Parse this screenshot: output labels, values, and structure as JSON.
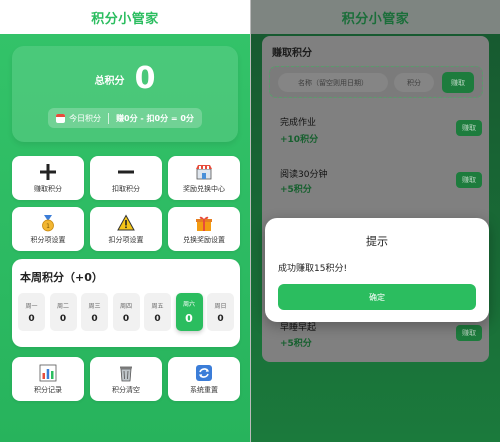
{
  "app_title": "积分小管家",
  "home": {
    "total_label": "总积分",
    "total_value": "0",
    "today_label": "今日积分",
    "today_formula": "赚0分 - 扣0分 = 0分",
    "menu_row1": [
      {
        "label": "赚取积分",
        "icon": "plus-icon"
      },
      {
        "label": "扣取积分",
        "icon": "minus-icon"
      },
      {
        "label": "奖励兑换中心",
        "icon": "shop-icon"
      }
    ],
    "menu_row2": [
      {
        "label": "积分项设置",
        "icon": "medal-icon"
      },
      {
        "label": "扣分项设置",
        "icon": "warning-icon"
      },
      {
        "label": "兑换奖励设置",
        "icon": "gift-icon"
      }
    ],
    "week_title": "本周积分（+0）",
    "days": [
      {
        "name": "周一",
        "value": "0"
      },
      {
        "name": "周二",
        "value": "0"
      },
      {
        "name": "周三",
        "value": "0"
      },
      {
        "name": "周四",
        "value": "0"
      },
      {
        "name": "周五",
        "value": "0"
      },
      {
        "name": "周六",
        "value": "0"
      },
      {
        "name": "周日",
        "value": "0"
      }
    ],
    "menu_row3": [
      {
        "label": "积分记录",
        "icon": "chart-icon"
      },
      {
        "label": "积分清空",
        "icon": "trash-icon"
      },
      {
        "label": "系统重置",
        "icon": "refresh-icon"
      }
    ]
  },
  "earn": {
    "title": "赚取积分",
    "name_placeholder": "名称（留空则用日期）",
    "points_placeholder": "积分",
    "add_button": "赚取",
    "tasks": [
      {
        "name": "完成作业",
        "points": "+10积分",
        "button": "赚取"
      },
      {
        "name": "阅读30分钟",
        "points": "+5积分",
        "button": "赚取"
      },
      {
        "name": "早睡早起",
        "points": "+5积分",
        "button": "赚取"
      }
    ]
  },
  "dialog": {
    "title": "提示",
    "message": "成功赚取15积分!",
    "confirm": "确定"
  },
  "colors": {
    "brand_green": "#2bbd5f",
    "dark_green": "#1d7c3d"
  }
}
